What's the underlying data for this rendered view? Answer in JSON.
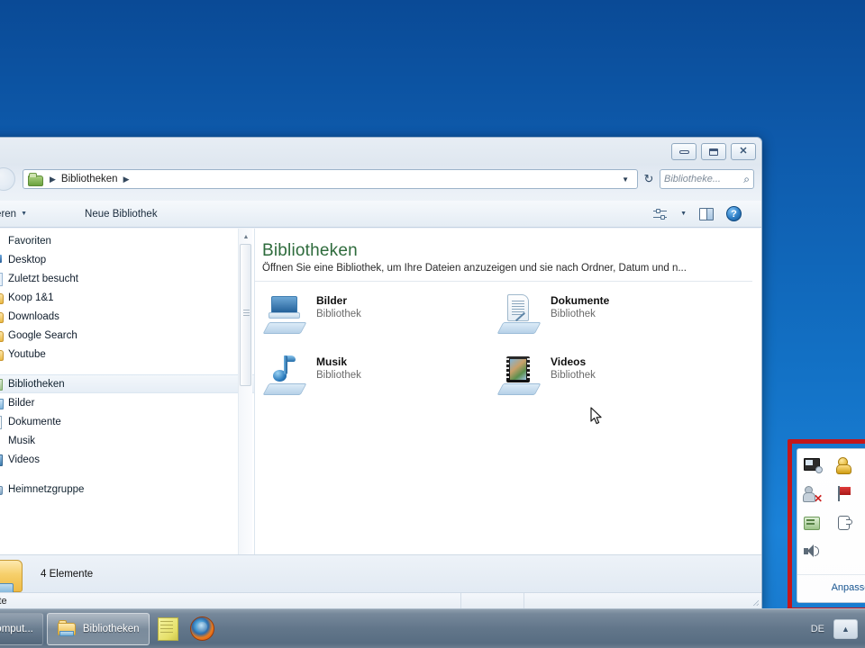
{
  "desktop": {
    "background_top_color": "#0a4a96",
    "background_bottom_color": "#1878cb"
  },
  "window": {
    "titlebar": {
      "minimize_label": "–",
      "maximize_label": "□",
      "close_label": "✕"
    },
    "address_bar": {
      "crumb_root": "Bibliotheken",
      "separator1": "▶",
      "separator2": "▶",
      "dropdown_caret": "▼",
      "refresh_label": "↻"
    },
    "search": {
      "placeholder": "Bibliotheke...",
      "icon": "search-icon",
      "glyph": "⌕"
    },
    "command_bar": {
      "organize_label": "ganisieren",
      "organize_caret": "▼",
      "new_library_label": "Neue Bibliothek",
      "view_caret": "▼",
      "help_label": "?"
    },
    "navigation_pane": {
      "sections": [
        {
          "header": "Favoriten",
          "icon": "star-icon",
          "items": [
            {
              "label": "Desktop",
              "icon": "desktop-icon"
            },
            {
              "label": "Zuletzt besucht",
              "icon": "recent-places-icon"
            },
            {
              "label": "Koop 1&1",
              "icon": "folder-icon"
            },
            {
              "label": "Downloads",
              "icon": "downloads-icon"
            },
            {
              "label": "Google Search",
              "icon": "link-folder-icon"
            },
            {
              "label": "Youtube",
              "icon": "link-folder-icon"
            }
          ]
        },
        {
          "header": "Bibliotheken",
          "icon": "library-icon",
          "selected": true,
          "items": [
            {
              "label": "Bilder",
              "icon": "pictures-icon"
            },
            {
              "label": "Dokumente",
              "icon": "documents-icon"
            },
            {
              "label": "Musik",
              "icon": "music-icon"
            },
            {
              "label": "Videos",
              "icon": "videos-icon"
            }
          ]
        },
        {
          "header": "Heimnetzgruppe",
          "icon": "homegroup-icon",
          "items": []
        }
      ],
      "scrollbar": {
        "up_arrow": "▲",
        "down_arrow": "▼"
      }
    },
    "content": {
      "title": "Bibliotheken",
      "subtitle": "Öffnen Sie eine Bibliothek, um Ihre Dateien anzuzeigen und sie nach Ordner, Datum und n...",
      "libraries": [
        {
          "name": "Bilder",
          "type": "Bibliothek",
          "icon": "pictures-library-icon"
        },
        {
          "name": "Dokumente",
          "type": "Bibliothek",
          "icon": "documents-library-icon"
        },
        {
          "name": "Musik",
          "type": "Bibliothek",
          "icon": "music-library-icon"
        },
        {
          "name": "Videos",
          "type": "Bibliothek",
          "icon": "videos-library-icon"
        }
      ]
    },
    "details_pane": {
      "icon": "library-folder-icon",
      "item_count": "4 Elemente"
    },
    "status_bar": {
      "left_text": "mente",
      "middle_text": "",
      "right_text": ""
    }
  },
  "tray_flyout": {
    "icons": [
      {
        "name": "network-monitor-icon"
      },
      {
        "name": "gold-figure-icon"
      },
      {
        "name": "orange-app-icon"
      },
      {
        "name": "user-blocked-icon"
      },
      {
        "name": "red-flag-icon"
      },
      {
        "name": "red-app-icon"
      },
      {
        "name": "green-app-icon"
      },
      {
        "name": "hand-pointer-icon"
      },
      {
        "name": "gray-app-icon"
      },
      {
        "name": "speaker-icon"
      }
    ],
    "customize_label": "Anpasse"
  },
  "annotation": {
    "color": "#c4171a",
    "shape": "rectangle-with-arrow"
  },
  "taskbar": {
    "buttons": [
      {
        "label": "Comput...",
        "icon": "computer-icon",
        "active": false
      },
      {
        "label": "Bibliotheken",
        "icon": "folder-library-icon",
        "active": true
      }
    ],
    "quick_icons": [
      {
        "name": "sticky-notes-icon"
      },
      {
        "name": "firefox-icon"
      }
    ],
    "language_indicator": "DE",
    "tray_expand_label": "▲"
  }
}
